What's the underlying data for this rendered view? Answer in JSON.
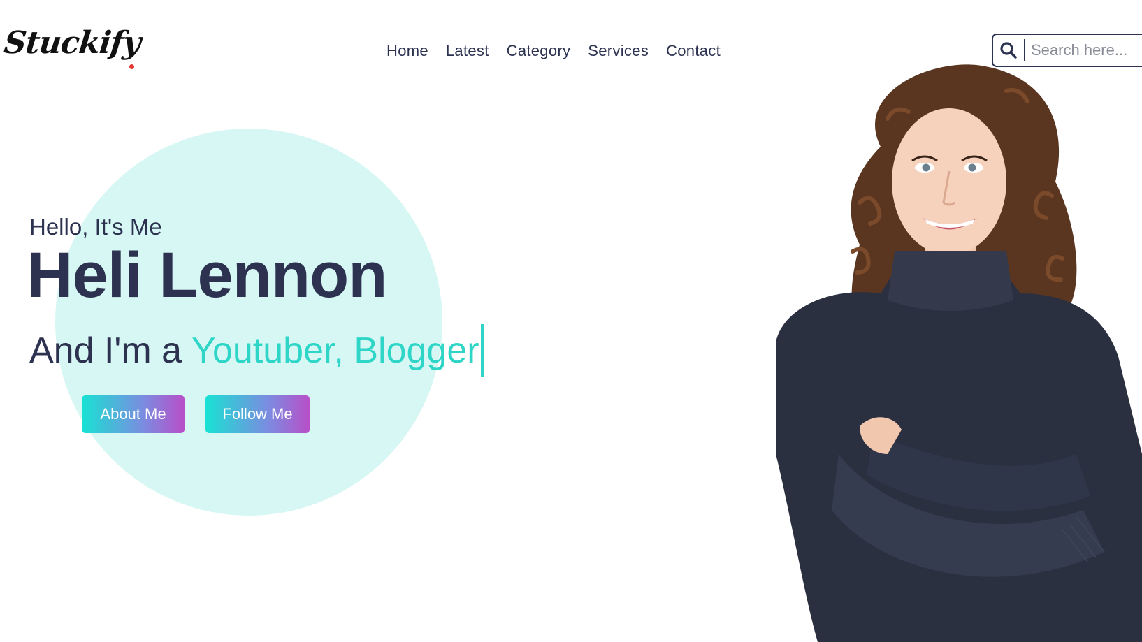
{
  "header": {
    "logo_text": "Stuckify",
    "nav": [
      "Home",
      "Latest",
      "Category",
      "Services",
      "Contact"
    ],
    "search_placeholder": "Search here..."
  },
  "hero": {
    "greeting": "Hello, It's Me",
    "name": "Heli Lennon",
    "tagline_prefix": "And I'm a",
    "tagline_roles": "Youtuber, Blogger",
    "buttons": {
      "about": "About Me",
      "follow": "Follow Me"
    }
  },
  "colors": {
    "text_dark": "#2c3250",
    "accent": "#2fd6c8",
    "circle_bg": "#d6f7f3",
    "logo_dot": "#e53935",
    "button_gradient": [
      "#18e2d3",
      "#b94fc8"
    ]
  },
  "icons": {
    "search": "search-icon"
  }
}
